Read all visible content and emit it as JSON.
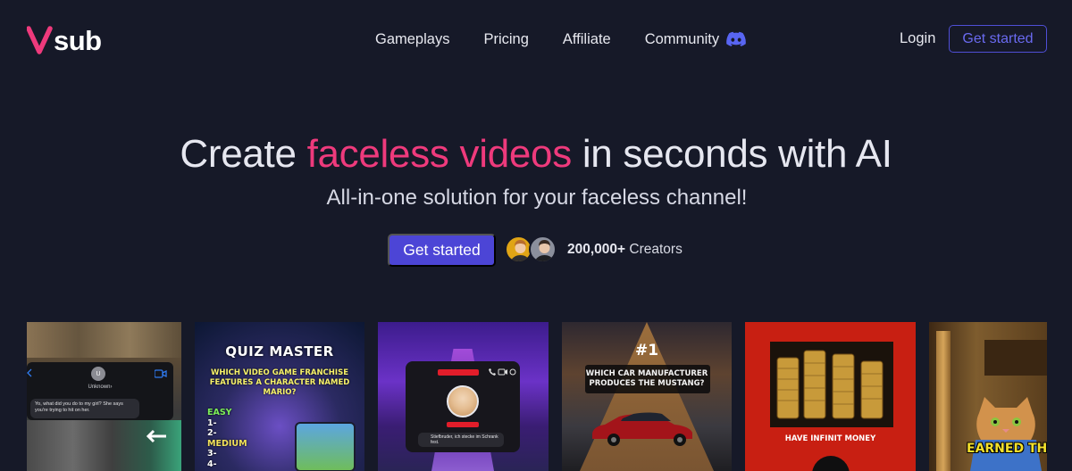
{
  "brand": {
    "logo_text": "sub",
    "accent": "#ee3a7c"
  },
  "nav": {
    "items": [
      {
        "label": "Gameplays"
      },
      {
        "label": "Pricing"
      },
      {
        "label": "Affiliate"
      },
      {
        "label": "Community",
        "icon": "discord-icon"
      }
    ],
    "login_label": "Login",
    "get_started_label": "Get started"
  },
  "hero": {
    "title_before": "Create ",
    "title_accent": "faceless videos",
    "title_after": " in seconds with AI",
    "subtitle": "All-in-one solution for your faceless channel!",
    "cta_label": "Get started",
    "creators_count": "200,000+",
    "creators_label": "Creators"
  },
  "cards": [
    {
      "contact_initial": "U",
      "contact_name": "Unknown",
      "message": "Yo, what did you do to my girl? She says you're trying to hit on her."
    },
    {
      "title": "QUIZ MASTER",
      "question": "WHICH VIDEO GAME FRANCHISE FEATURES A CHARACTER NAMED MARIO?",
      "level_easy": "EASY",
      "level_1": "1-",
      "level_2": "2-",
      "level_medium": "MEDIUM",
      "level_3": "3-",
      "level_4": "4-"
    },
    {
      "message": "Stiefbruder, ich stecke im Schrank fest."
    },
    {
      "rank": "#1",
      "question": "WHICH CAR MANUFACTURER PRODUCES THE MUSTANG?"
    },
    {
      "caption": "HAVE INFINIT MONEY"
    },
    {
      "caption": "EARNED THE"
    }
  ],
  "colors": {
    "background": "#161928",
    "primary": "#4c45d6",
    "outline": "#4f4fd6",
    "accent_pink": "#ee3a7c"
  }
}
